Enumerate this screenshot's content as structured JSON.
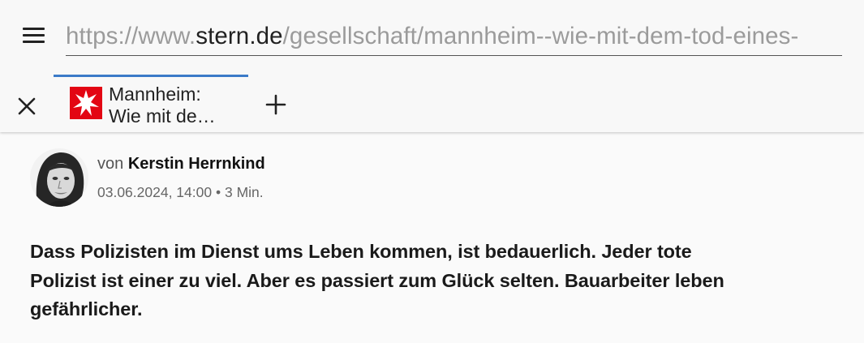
{
  "browser": {
    "url_prefix": "https://www.",
    "url_host": "stern.de",
    "url_path": "/gesellschaft/mannheim--wie-mit-dem-tod-eines-",
    "menu_icon": "hamburger-menu-icon",
    "close_icon": "close-icon",
    "new_tab_icon": "plus-icon",
    "accent_color": "#3b7bc8"
  },
  "tab": {
    "title_line1": "Mannheim:",
    "title_line2": "Wie mit de…",
    "favicon": "stern-logo-icon",
    "favicon_color": "#e30613"
  },
  "article": {
    "byline_prefix": "von",
    "author": "Kerstin Herrnkind",
    "date": "03.06.2024, 14:00",
    "separator": "•",
    "read_time": "3 Min.",
    "lead": "Dass Polizisten im Dienst ums Leben kommen, ist bedauerlich. Jeder tote Polizist ist einer zu viel. Aber es passiert zum Glück selten. Bauarbeiter leben gefährlicher."
  }
}
